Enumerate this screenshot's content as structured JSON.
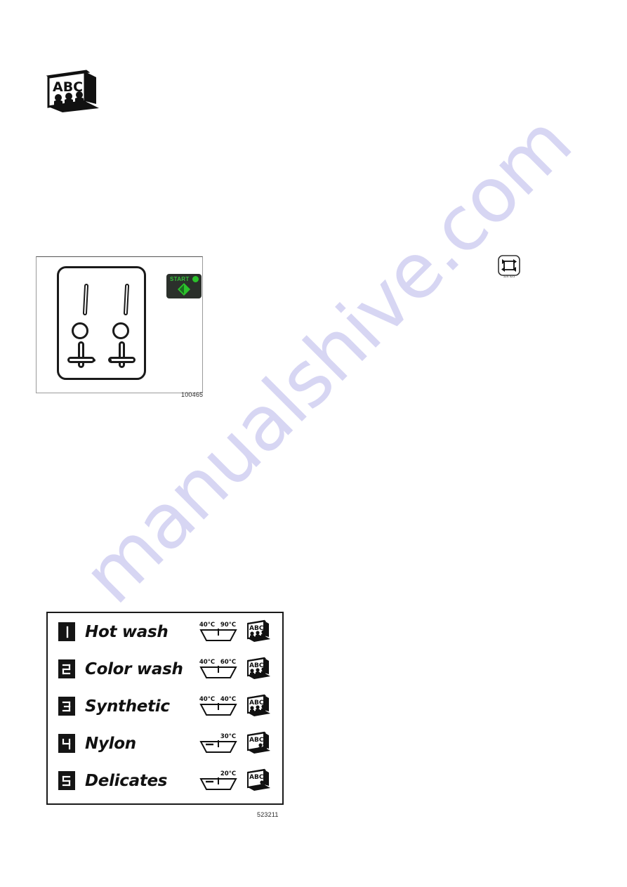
{
  "document": {
    "watermark": "manualshive.com"
  },
  "figures": {
    "panel": {
      "caption": "100465",
      "start_button": {
        "label": "START",
        "led_color": "#2bc22b",
        "body_color": "#2b302b",
        "text_color": "#35c13a",
        "icon": "start-diamond-arrow"
      },
      "controls": [
        {
          "name": "control-left"
        },
        {
          "name": "control-right"
        }
      ]
    },
    "program_table": {
      "caption": "523211",
      "rows": [
        {
          "number": "1",
          "name": "Hot wash",
          "temps": [
            "40°C",
            "90°C"
          ],
          "wash_symbol": "wash-tub-two-bar",
          "care_icon": "abc-board-icon"
        },
        {
          "number": "2",
          "name": "Color wash",
          "temps": [
            "40°C",
            "60°C"
          ],
          "wash_symbol": "wash-tub-two-bar",
          "care_icon": "abc-board-icon"
        },
        {
          "number": "3",
          "name": "Synthetic",
          "temps": [
            "40°C",
            "40°C"
          ],
          "wash_symbol": "wash-tub-two-bar",
          "care_icon": "abc-board-icon"
        },
        {
          "number": "4",
          "name": "Nylon",
          "temps": [
            "30°C"
          ],
          "wash_symbol": "wash-tub-dash-bar",
          "care_icon": "abc-board-icon"
        },
        {
          "number": "5",
          "name": "Delicates",
          "temps": [
            "20°C"
          ],
          "wash_symbol": "wash-tub-dash-bar",
          "care_icon": "abc-board-icon"
        }
      ]
    }
  },
  "icons": {
    "top_left": "abc-board-icon",
    "top_right": "cycle-arrows-icon"
  },
  "colors": {
    "ink": "#111111",
    "start_green": "#2bc22b",
    "start_body": "#2b302b",
    "watermark": "#c9c7ef"
  }
}
